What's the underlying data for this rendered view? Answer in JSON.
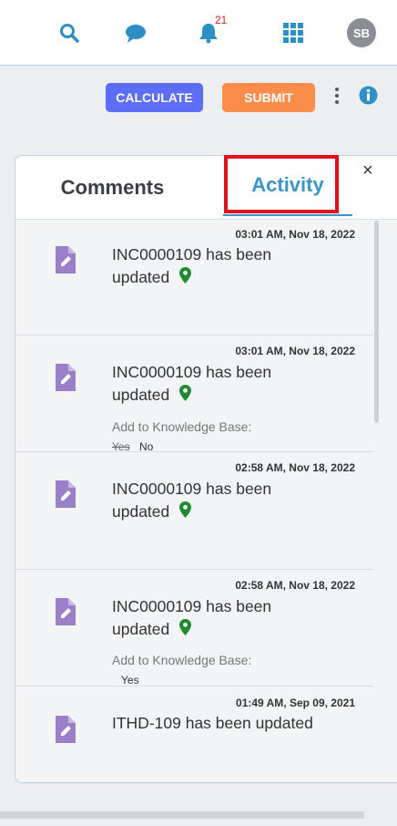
{
  "topbar": {
    "notification_count": "21",
    "avatar_initials": "SB"
  },
  "actions": {
    "calculate_label": "CALCULATE",
    "submit_label": "SUBMIT"
  },
  "panel": {
    "tabs": [
      {
        "label": "Comments"
      },
      {
        "label": "Activity"
      }
    ],
    "close_label": "×",
    "items": [
      {
        "timestamp": "03:01 AM, Nov 18, 2022",
        "message": "INC0000109 has been updated"
      },
      {
        "timestamp": "03:01 AM, Nov 18, 2022",
        "message": "INC0000109 has been updated",
        "kb_label": "Add to Knowledge Base:",
        "kb_old": "Yes",
        "kb_new": "No"
      },
      {
        "timestamp": "02:58 AM, Nov 18, 2022",
        "message": "INC0000109 has been updated"
      },
      {
        "timestamp": "02:58 AM, Nov 18, 2022",
        "message": "INC0000109 has been updated",
        "kb_label": "Add to Knowledge Base:",
        "kb_new": "Yes"
      },
      {
        "timestamp": "01:49 AM, Sep 09, 2021",
        "message": "ITHD-109 has been updated"
      }
    ]
  },
  "colors": {
    "accent": "#3a95cc",
    "calculate": "#5b6ef5",
    "submit": "#fb8d4b",
    "doc_icon": "#9b7fc8",
    "pin": "#1f8a2e",
    "highlight": "#e0101b"
  },
  "icons": [
    "search-icon",
    "chat-icon",
    "bell-icon",
    "apps-grid-icon",
    "more-vertical-icon",
    "info-icon",
    "document-edit-icon",
    "location-pin-icon",
    "close-icon"
  ]
}
